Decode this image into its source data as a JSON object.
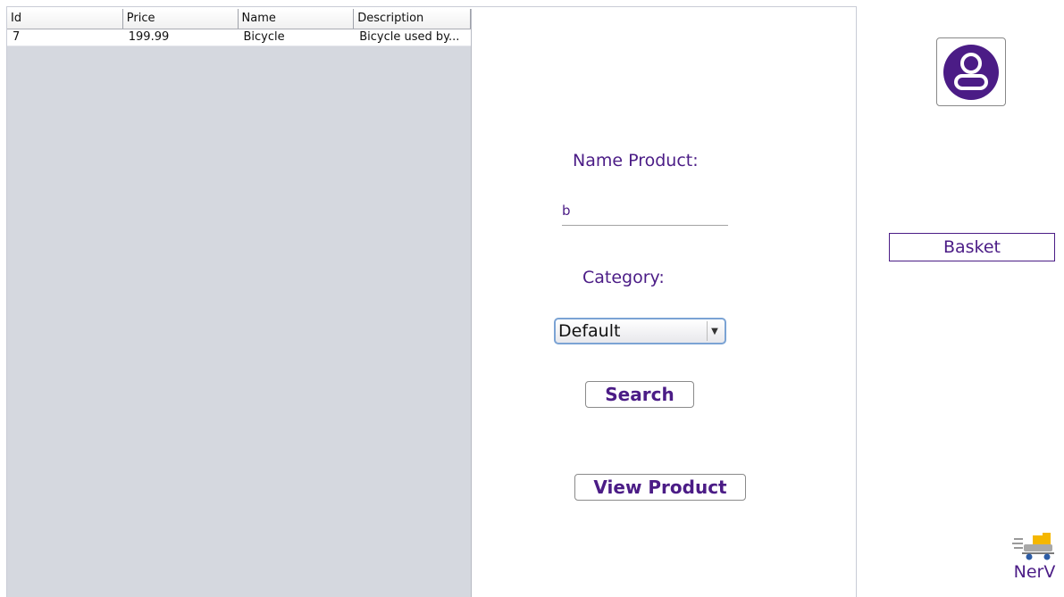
{
  "table": {
    "columns": [
      "Id",
      "Price",
      "Name",
      "Description"
    ],
    "rows": [
      [
        "7",
        "199.99",
        "Bicycle",
        "Bicycle used by..."
      ]
    ]
  },
  "form": {
    "name_label": "Name Product:",
    "name_value": "b",
    "category_label": "Category:",
    "category_selected": "Default",
    "search_label": "Search",
    "view_product_label": "View Product"
  },
  "sidebar": {
    "basket_label": "Basket",
    "logo_text": "NerV"
  },
  "colors": {
    "accent": "#4b1c86",
    "table_bg": "#d5d8df"
  },
  "icons": {
    "profile": "user-avatar-icon",
    "dropdown": "chevron-down-icon",
    "logo": "delivery-cart-logo"
  }
}
